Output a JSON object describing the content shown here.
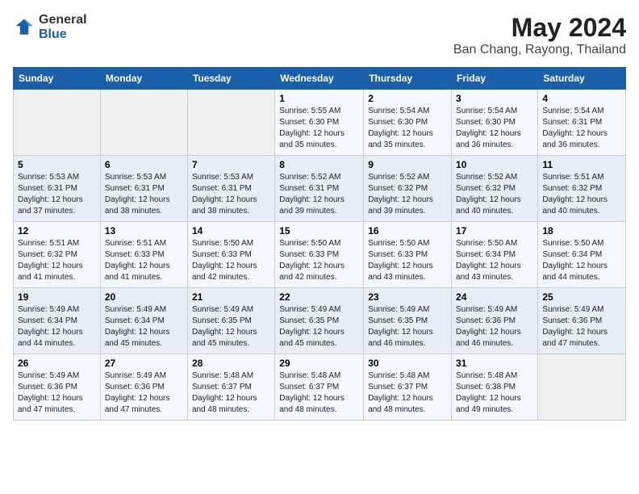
{
  "header": {
    "logo_general": "General",
    "logo_blue": "Blue",
    "title": "May 2024",
    "subtitle": "Ban Chang, Rayong, Thailand"
  },
  "calendar": {
    "weekdays": [
      "Sunday",
      "Monday",
      "Tuesday",
      "Wednesday",
      "Thursday",
      "Friday",
      "Saturday"
    ],
    "weeks": [
      [
        {
          "day": "",
          "info": ""
        },
        {
          "day": "",
          "info": ""
        },
        {
          "day": "",
          "info": ""
        },
        {
          "day": "1",
          "info": "Sunrise: 5:55 AM\nSunset: 6:30 PM\nDaylight: 12 hours\nand 35 minutes."
        },
        {
          "day": "2",
          "info": "Sunrise: 5:54 AM\nSunset: 6:30 PM\nDaylight: 12 hours\nand 35 minutes."
        },
        {
          "day": "3",
          "info": "Sunrise: 5:54 AM\nSunset: 6:30 PM\nDaylight: 12 hours\nand 36 minutes."
        },
        {
          "day": "4",
          "info": "Sunrise: 5:54 AM\nSunset: 6:31 PM\nDaylight: 12 hours\nand 36 minutes."
        }
      ],
      [
        {
          "day": "5",
          "info": "Sunrise: 5:53 AM\nSunset: 6:31 PM\nDaylight: 12 hours\nand 37 minutes."
        },
        {
          "day": "6",
          "info": "Sunrise: 5:53 AM\nSunset: 6:31 PM\nDaylight: 12 hours\nand 38 minutes."
        },
        {
          "day": "7",
          "info": "Sunrise: 5:53 AM\nSunset: 6:31 PM\nDaylight: 12 hours\nand 38 minutes."
        },
        {
          "day": "8",
          "info": "Sunrise: 5:52 AM\nSunset: 6:31 PM\nDaylight: 12 hours\nand 39 minutes."
        },
        {
          "day": "9",
          "info": "Sunrise: 5:52 AM\nSunset: 6:32 PM\nDaylight: 12 hours\nand 39 minutes."
        },
        {
          "day": "10",
          "info": "Sunrise: 5:52 AM\nSunset: 6:32 PM\nDaylight: 12 hours\nand 40 minutes."
        },
        {
          "day": "11",
          "info": "Sunrise: 5:51 AM\nSunset: 6:32 PM\nDaylight: 12 hours\nand 40 minutes."
        }
      ],
      [
        {
          "day": "12",
          "info": "Sunrise: 5:51 AM\nSunset: 6:32 PM\nDaylight: 12 hours\nand 41 minutes."
        },
        {
          "day": "13",
          "info": "Sunrise: 5:51 AM\nSunset: 6:33 PM\nDaylight: 12 hours\nand 41 minutes."
        },
        {
          "day": "14",
          "info": "Sunrise: 5:50 AM\nSunset: 6:33 PM\nDaylight: 12 hours\nand 42 minutes."
        },
        {
          "day": "15",
          "info": "Sunrise: 5:50 AM\nSunset: 6:33 PM\nDaylight: 12 hours\nand 42 minutes."
        },
        {
          "day": "16",
          "info": "Sunrise: 5:50 AM\nSunset: 6:33 PM\nDaylight: 12 hours\nand 43 minutes."
        },
        {
          "day": "17",
          "info": "Sunrise: 5:50 AM\nSunset: 6:34 PM\nDaylight: 12 hours\nand 43 minutes."
        },
        {
          "day": "18",
          "info": "Sunrise: 5:50 AM\nSunset: 6:34 PM\nDaylight: 12 hours\nand 44 minutes."
        }
      ],
      [
        {
          "day": "19",
          "info": "Sunrise: 5:49 AM\nSunset: 6:34 PM\nDaylight: 12 hours\nand 44 minutes."
        },
        {
          "day": "20",
          "info": "Sunrise: 5:49 AM\nSunset: 6:34 PM\nDaylight: 12 hours\nand 45 minutes."
        },
        {
          "day": "21",
          "info": "Sunrise: 5:49 AM\nSunset: 6:35 PM\nDaylight: 12 hours\nand 45 minutes."
        },
        {
          "day": "22",
          "info": "Sunrise: 5:49 AM\nSunset: 6:35 PM\nDaylight: 12 hours\nand 45 minutes."
        },
        {
          "day": "23",
          "info": "Sunrise: 5:49 AM\nSunset: 6:35 PM\nDaylight: 12 hours\nand 46 minutes."
        },
        {
          "day": "24",
          "info": "Sunrise: 5:49 AM\nSunset: 6:36 PM\nDaylight: 12 hours\nand 46 minutes."
        },
        {
          "day": "25",
          "info": "Sunrise: 5:49 AM\nSunset: 6:36 PM\nDaylight: 12 hours\nand 47 minutes."
        }
      ],
      [
        {
          "day": "26",
          "info": "Sunrise: 5:49 AM\nSunset: 6:36 PM\nDaylight: 12 hours\nand 47 minutes."
        },
        {
          "day": "27",
          "info": "Sunrise: 5:49 AM\nSunset: 6:36 PM\nDaylight: 12 hours\nand 47 minutes."
        },
        {
          "day": "28",
          "info": "Sunrise: 5:48 AM\nSunset: 6:37 PM\nDaylight: 12 hours\nand 48 minutes."
        },
        {
          "day": "29",
          "info": "Sunrise: 5:48 AM\nSunset: 6:37 PM\nDaylight: 12 hours\nand 48 minutes."
        },
        {
          "day": "30",
          "info": "Sunrise: 5:48 AM\nSunset: 6:37 PM\nDaylight: 12 hours\nand 48 minutes."
        },
        {
          "day": "31",
          "info": "Sunrise: 5:48 AM\nSunset: 6:38 PM\nDaylight: 12 hours\nand 49 minutes."
        },
        {
          "day": "",
          "info": ""
        }
      ]
    ]
  }
}
